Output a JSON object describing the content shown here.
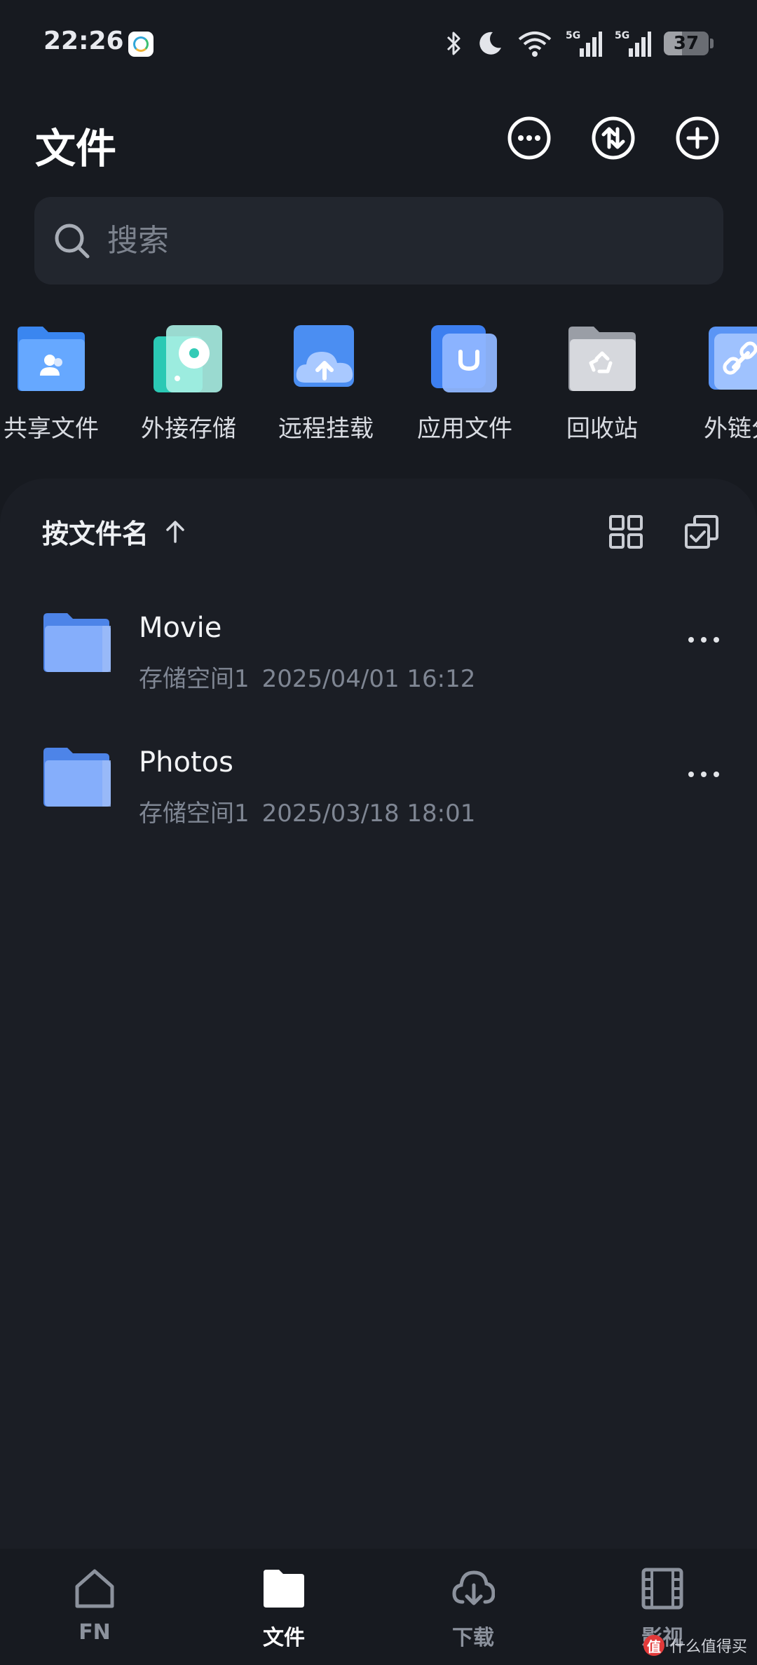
{
  "status_bar": {
    "time": "22:26",
    "battery": "37",
    "signal_1": "5G",
    "signal_2": "5G",
    "icons": [
      "app-icon",
      "bluetooth-icon",
      "moon-icon",
      "wifi-icon",
      "signal-icon",
      "signal-icon",
      "battery-icon"
    ]
  },
  "header": {
    "title": "文件",
    "actions": [
      "more-icon",
      "transfer-icon",
      "add-icon"
    ]
  },
  "search": {
    "placeholder": "搜索"
  },
  "quick_access": [
    {
      "label": "共享文件",
      "icon": "shared-folder-icon"
    },
    {
      "label": "外接存储",
      "icon": "external-storage-icon"
    },
    {
      "label": "远程挂载",
      "icon": "remote-mount-icon"
    },
    {
      "label": "应用文件",
      "icon": "app-files-icon"
    },
    {
      "label": "回收站",
      "icon": "recycle-bin-icon"
    },
    {
      "label": "外链分",
      "icon": "share-link-icon"
    }
  ],
  "list": {
    "sort_label": "按文件名",
    "sort_direction_icon": "arrow-up-icon",
    "files": [
      {
        "name": "Movie",
        "location": "存储空间1",
        "date": "2025/04/01 16:12"
      },
      {
        "name": "Photos",
        "location": "存储空间1",
        "date": "2025/03/18 18:01"
      }
    ]
  },
  "bottom_nav": {
    "active": "文件",
    "items": [
      {
        "label": "FN",
        "icon": "home-icon"
      },
      {
        "label": "文件",
        "icon": "folder-icon"
      },
      {
        "label": "下载",
        "icon": "download-icon"
      },
      {
        "label": "影视",
        "icon": "film-icon"
      }
    ]
  },
  "watermark": {
    "badge": "值",
    "text": "什么值得买"
  },
  "colors": {
    "background": "#171a20",
    "panel": "#1b1e25",
    "search_bg": "#22262e",
    "folder_blue": "#7fa8ff",
    "secondary_text": "#7f8693"
  }
}
